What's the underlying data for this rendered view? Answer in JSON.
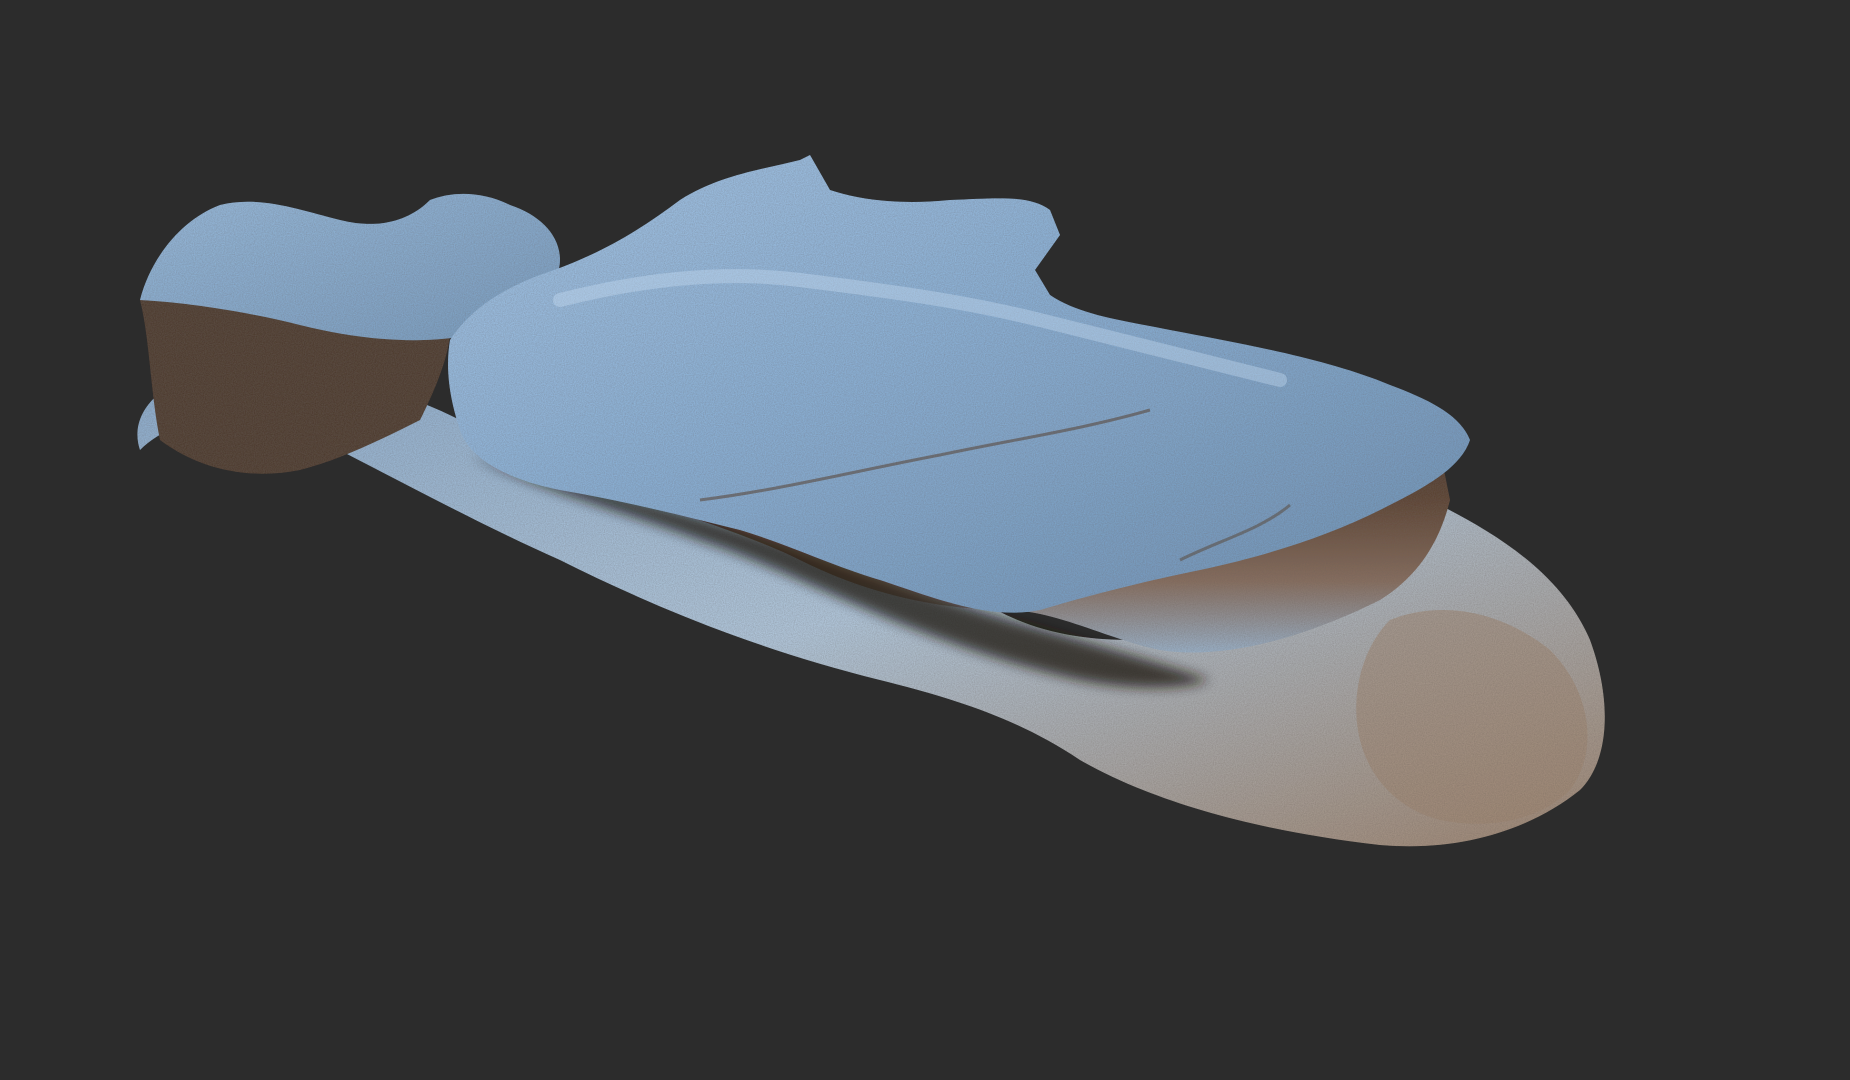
{
  "viewport": {
    "background_color": "#2c2c2c",
    "object": "sculpted-rock-model",
    "material_colors": {
      "highlight_blue": "#9cc2e6",
      "mid_blue": "#5f89b0",
      "bronze_shadow": "#6b4a33",
      "deep_shadow": "#1c120c",
      "warm_highlight": "#d9c3a8"
    }
  }
}
